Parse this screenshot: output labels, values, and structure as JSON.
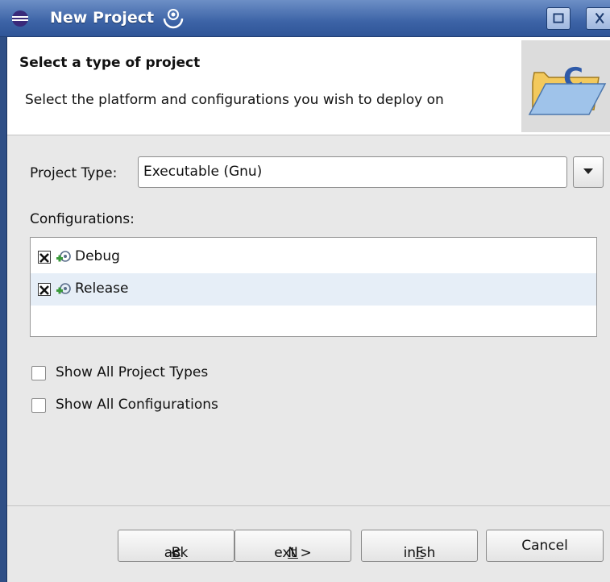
{
  "window": {
    "title": "New Project",
    "app_icon": "eclipse-icon",
    "buttons": [
      "maximize-icon",
      "close-icon"
    ]
  },
  "banner": {
    "title": "Select a type of project",
    "description": "Select the platform and configurations you wish to deploy on",
    "icon": "c-project-folder-icon"
  },
  "form": {
    "project_type_label": "Project Type:",
    "project_type_value": "Executable (Gnu)",
    "configurations_label": "Configurations:",
    "configurations": [
      {
        "label": "Debug",
        "checked": true,
        "icon": "configuration-icon"
      },
      {
        "label": "Release",
        "checked": true,
        "icon": "configuration-icon"
      }
    ],
    "show_all_project_types": {
      "label": "Show All Project Types",
      "checked": false
    },
    "show_all_configurations": {
      "label": "Show All Configurations",
      "checked": false
    }
  },
  "buttons": {
    "back_prefix": "< ",
    "back_mnemonic": "B",
    "back_rest": "ack",
    "next_mnemonic": "N",
    "next_rest": "ext >",
    "finish_mnemonic": "F",
    "finish_rest": "inish",
    "cancel": "Cancel"
  },
  "colors": {
    "titlebar": "#3c63a6",
    "selected_row": "#e6eef7"
  }
}
